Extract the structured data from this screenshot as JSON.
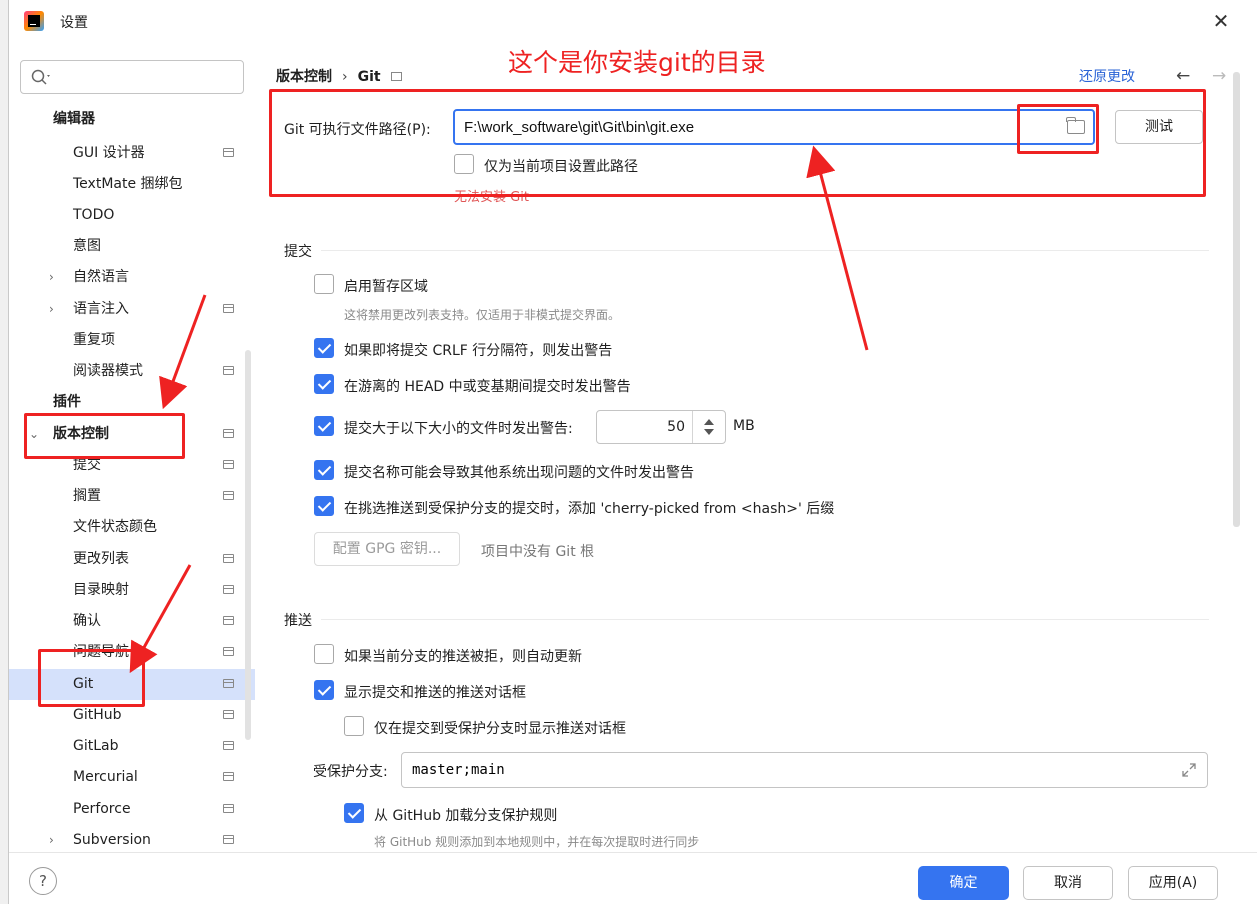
{
  "window": {
    "title": "设置",
    "close_icon": "close-icon"
  },
  "sidebar": {
    "search_placeholder": "",
    "items": [
      {
        "label": "编辑器",
        "kind": "category"
      },
      {
        "label": "GUI 设计器"
      },
      {
        "label": "TextMate 捆绑包"
      },
      {
        "label": "TODO"
      },
      {
        "label": "意图"
      },
      {
        "label": "自然语言",
        "expandable": true
      },
      {
        "label": "语言注入",
        "expandable": true
      },
      {
        "label": "重复项"
      },
      {
        "label": "阅读器模式"
      },
      {
        "label": "插件",
        "kind": "category"
      },
      {
        "label": "版本控制",
        "kind": "category",
        "expanded": true
      },
      {
        "label": "提交"
      },
      {
        "label": "搁置"
      },
      {
        "label": "文件状态颜色"
      },
      {
        "label": "更改列表"
      },
      {
        "label": "目录映射"
      },
      {
        "label": "确认"
      },
      {
        "label": "问题导航"
      },
      {
        "label": "Git",
        "selected": true
      },
      {
        "label": "GitHub"
      },
      {
        "label": "GitLab"
      },
      {
        "label": "Mercurial"
      },
      {
        "label": "Perforce"
      },
      {
        "label": "Subversion",
        "expandable": true
      }
    ],
    "help_label": "?"
  },
  "content": {
    "breadcrumb": {
      "parent": "版本控制",
      "separator": "›",
      "current": "Git"
    },
    "revert_label": "还原更改",
    "git_path": {
      "label": "Git 可执行文件路径(P):",
      "value": "F:\\work_software\\git\\Git\\bin\\git.exe",
      "test_label": "测试",
      "project_only_label": "仅为当前项目设置此路径",
      "error_text": "无法安装 Git"
    },
    "commit_section": {
      "title": "提交",
      "staging_label": "启用暂存区域",
      "staging_hint": "这将禁用更改列表支持。仅适用于非模式提交界面。",
      "crlf_label": "如果即将提交 CRLF 行分隔符，则发出警告",
      "detached_label": "在游离的 HEAD 中或变基期间提交时发出警告",
      "large_file_label": "提交大于以下大小的文件时发出警告:",
      "large_file_value": "50",
      "large_file_unit": "MB",
      "bad_names_label": "提交名称可能会导致其他系统出现问题的文件时发出警告",
      "cherry_pick_label": "在挑选推送到受保护分支的提交时，添加 'cherry-picked from <hash>' 后缀",
      "gpg_label": "配置 GPG 密钥...",
      "no_git_root": "项目中没有 Git 根"
    },
    "push_section": {
      "title": "推送",
      "auto_update_label": "如果当前分支的推送被拒，则自动更新",
      "show_dialog_label": "显示提交和推送的推送对话框",
      "protected_only_label": "仅在提交到受保护分支时显示推送对话框",
      "protected_branches_label": "受保护分支:",
      "protected_branches_value": "master;main",
      "load_github_label": "从 GitHub 加载分支保护规则",
      "load_github_hint": "将 GitHub 规则添加到本地规则中，并在每次提取时进行同步"
    }
  },
  "footer": {
    "ok_label": "确定",
    "cancel_label": "取消",
    "apply_label": "应用(A)"
  },
  "annotation": {
    "text": "这个是你安装git的目录",
    "color": "#ee2222"
  },
  "colors": {
    "accent": "#3574f0",
    "selection": "#d5e1fb",
    "error": "#e05555",
    "link": "#2a63d6"
  }
}
